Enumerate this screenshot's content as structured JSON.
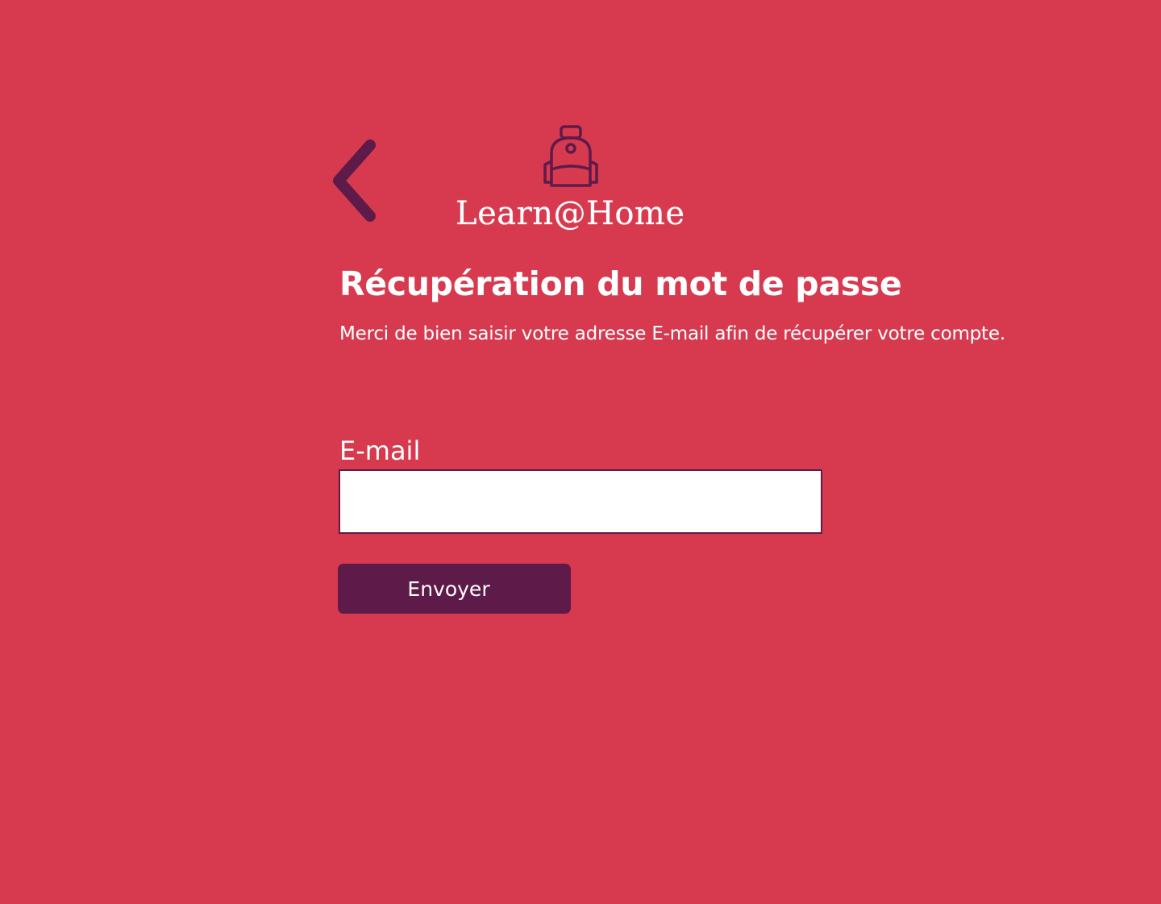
{
  "colors": {
    "background": "#d73a4f",
    "accent": "#5e1b4a",
    "text": "#ffffff"
  },
  "nav": {
    "back_icon": "chevron-left-icon"
  },
  "brand": {
    "icon": "backpack-icon",
    "name": "Learn@Home"
  },
  "page": {
    "title": "Récupération du mot de passe",
    "subtitle": "Merci de bien saisir votre adresse E-mail afin de récupérer votre compte."
  },
  "form": {
    "email_label": "E-mail",
    "email_value": "",
    "submit_label": "Envoyer"
  }
}
